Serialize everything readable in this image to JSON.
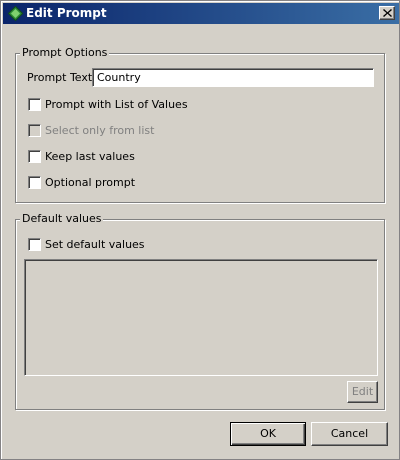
{
  "window": {
    "title": "Edit Prompt",
    "icon": "green-diamond-icon",
    "close_icon": "close-icon"
  },
  "prompt_options": {
    "legend": "Prompt Options",
    "prompt_text_label": "Prompt Text",
    "prompt_text_value": "Country",
    "checkboxes": [
      {
        "label": "Prompt with List of Values",
        "checked": false,
        "enabled": true
      },
      {
        "label": "Select only from list",
        "checked": false,
        "enabled": false
      },
      {
        "label": "Keep last values",
        "checked": false,
        "enabled": true
      },
      {
        "label": "Optional prompt",
        "checked": false,
        "enabled": true
      }
    ]
  },
  "default_values": {
    "legend": "Default values",
    "set_default_label": "Set default values",
    "set_default_checked": false,
    "edit_label": "Edit",
    "edit_enabled": false
  },
  "buttons": {
    "ok_label": "OK",
    "cancel_label": "Cancel"
  },
  "colors": {
    "title_bar_start": "#0a246a",
    "title_bar_end": "#3a6ea5",
    "dialog_background": "#d4d0c8",
    "icon_green": "#2e8b3a"
  }
}
